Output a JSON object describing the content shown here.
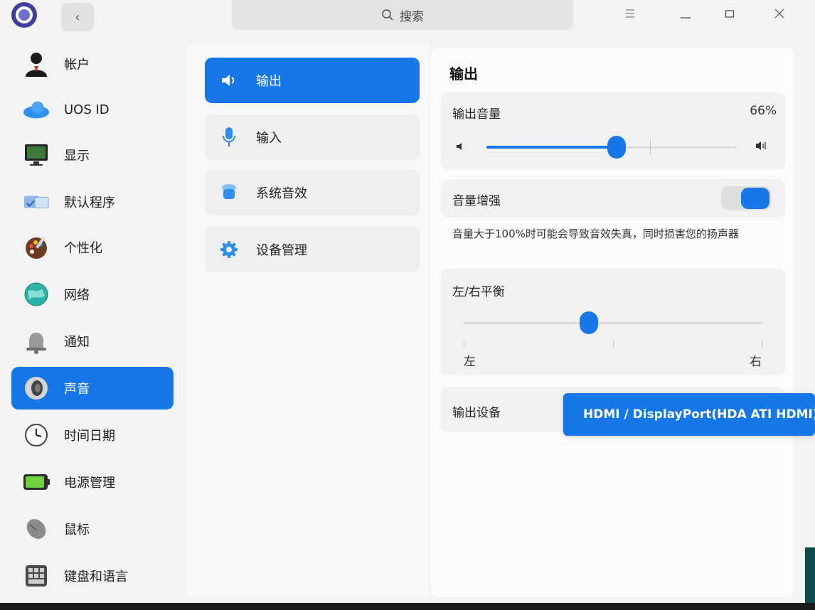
{
  "search": {
    "label": "搜索"
  },
  "sidebar": {
    "items": [
      {
        "label": "帐户",
        "icon": "user-icon"
      },
      {
        "label": "UOS ID",
        "icon": "cloud-icon"
      },
      {
        "label": "显示",
        "icon": "monitor-icon"
      },
      {
        "label": "默认程序",
        "icon": "default-apps-icon"
      },
      {
        "label": "个性化",
        "icon": "palette-icon"
      },
      {
        "label": "网络",
        "icon": "globe-icon"
      },
      {
        "label": "通知",
        "icon": "bell-icon"
      },
      {
        "label": "声音",
        "icon": "speaker-icon"
      },
      {
        "label": "时间日期",
        "icon": "clock-icon"
      },
      {
        "label": "电源管理",
        "icon": "battery-icon"
      },
      {
        "label": "鼠标",
        "icon": "mouse-icon"
      },
      {
        "label": "键盘和语言",
        "icon": "keyboard-icon"
      }
    ],
    "active_index": 7
  },
  "sound_menu": {
    "items": [
      {
        "label": "输出",
        "icon": "speaker-output-icon"
      },
      {
        "label": "输入",
        "icon": "microphone-icon"
      },
      {
        "label": "系统音效",
        "icon": "system-sound-icon"
      },
      {
        "label": "设备管理",
        "icon": "gear-icon"
      }
    ],
    "active_index": 0
  },
  "output": {
    "title": "输出",
    "volume_label": "输出音量",
    "volume_value": "66%",
    "volume_fraction": 0.66,
    "boost_label": "音量增强",
    "boost_on": true,
    "boost_note": "音量大于100%时可能会导致音效失真，同时损害您的扬声器",
    "balance_label": "左/右平衡",
    "balance_left": "左",
    "balance_right": "右",
    "balance_fraction": 0.42,
    "device_label": "输出设备",
    "device_selected": "HDMI / DisplayPort(HDA ATI HDMI)"
  },
  "colors": {
    "accent": "#1678e8",
    "background": "#f3f3f3"
  }
}
